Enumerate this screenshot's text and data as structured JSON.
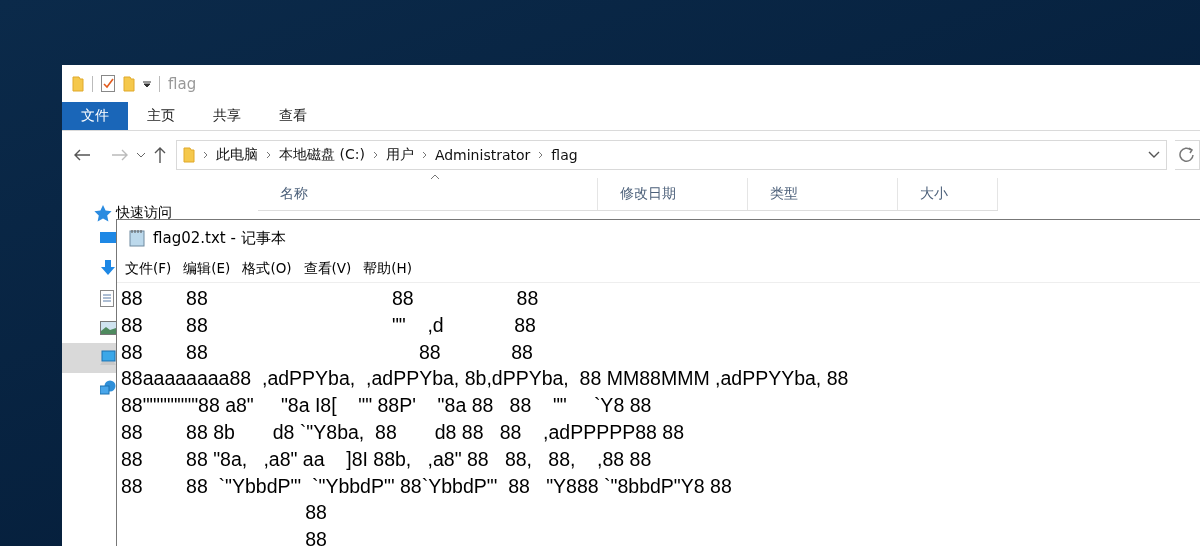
{
  "explorer": {
    "title": "flag",
    "ribbon_tabs": [
      {
        "label": "文件",
        "selected": true
      },
      {
        "label": "主页",
        "selected": false
      },
      {
        "label": "共享",
        "selected": false
      },
      {
        "label": "查看",
        "selected": false
      }
    ],
    "breadcrumbs": [
      "此电脑",
      "本地磁盘 (C:)",
      "用户",
      "Administrator",
      "flag"
    ],
    "columns": [
      "名称",
      "修改日期",
      "类型",
      "大小"
    ],
    "nav": {
      "header": "快速访问",
      "items": [
        {
          "kind": "desktop",
          "selected": false
        },
        {
          "kind": "download",
          "selected": false
        },
        {
          "kind": "document",
          "selected": false
        },
        {
          "kind": "picture",
          "selected": false
        },
        {
          "kind": "computer",
          "selected": true
        },
        {
          "kind": "network",
          "selected": false
        }
      ]
    }
  },
  "notepad": {
    "title": "flag02.txt - 记事本",
    "menu": [
      "文件(F)",
      "编辑(E)",
      "格式(O)",
      "查看(V)",
      "帮助(H)"
    ],
    "lines": [
      "88        88                                  88                   88",
      "88        88                                  \"\"    ,d             88",
      "88        88                                       88             88",
      "88aaaaaaaa88  ,adPPYba,  ,adPPYba, 8b,dPPYba,  88 MM88MMM ,adPPYYba, 88",
      "88\"\"\"\"\"\"\"\"88 a8\"     \"8a I8[    \"\" 88P'    \"8a 88   88    \"\"     `Y8 88",
      "88        88 8b       d8 `\"Y8ba,  88       d8 88   88    ,adPPPPP88 88",
      "88        88 \"8a,   ,a8\" aa    ]8I 88b,   ,a8\" 88   88,   88,    ,88 88",
      "88        88  `\"YbbdP\"'  `\"YbbdP\"' 88`YbbdP\"'  88   \"Y888 `\"8bbdP\"Y8 88",
      "                                  88",
      "                                  88"
    ]
  }
}
